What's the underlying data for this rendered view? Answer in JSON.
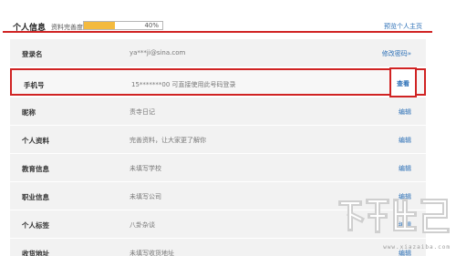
{
  "header": {
    "title": "个人信息",
    "completeness_label": "资料完善度",
    "completeness_percent": 40,
    "completeness_text": "40%",
    "preview_link": "预览个人主页"
  },
  "rows": [
    {
      "label": "登录名",
      "value": "ya***ji@sina.com",
      "action": "修改密码»"
    },
    {
      "label": "手机号",
      "value": "15*******00 可直接使用此号码登录",
      "action": "查看"
    },
    {
      "label": "昵称",
      "value": "责寺日记",
      "action": "编辑"
    },
    {
      "label": "个人资料",
      "value": "完善资料，让大家更了解你",
      "action": "编辑"
    },
    {
      "label": "教育信息",
      "value": "未填写学校",
      "action": "编辑"
    },
    {
      "label": "职业信息",
      "value": "未填写公司",
      "action": "编辑"
    },
    {
      "label": "个人标签",
      "value": "八卦杂谈",
      "action": "编辑"
    },
    {
      "label": "收货地址",
      "value": "未填写收货地址",
      "action": "编辑"
    }
  ],
  "watermark": {
    "url": "www.xiazaiba.com",
    "logo_icon": "xiazaiba-logo-icon"
  },
  "colors": {
    "accent_red": "#d02323",
    "link_blue": "#2b6fb6",
    "progress_fill": "#f4ba3e",
    "row_bg": "#f2f2f2"
  }
}
